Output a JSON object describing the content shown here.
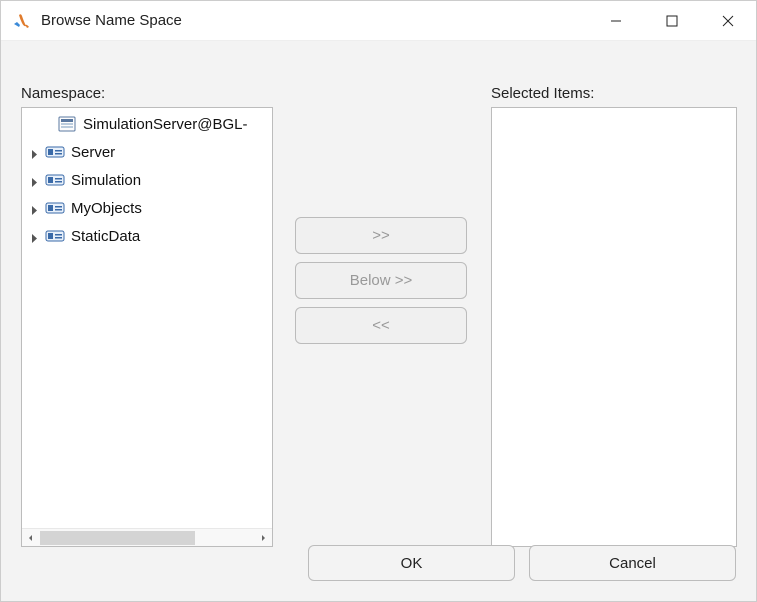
{
  "window": {
    "title": "Browse Name Space"
  },
  "labels": {
    "namespace": "Namespace:",
    "selected": "Selected Items:"
  },
  "tree": {
    "items": [
      {
        "label": "SimulationServer@BGL-",
        "icon": "server-root",
        "expandable": false,
        "root": true
      },
      {
        "label": "Server",
        "icon": "object",
        "expandable": true
      },
      {
        "label": "Simulation",
        "icon": "object",
        "expandable": true
      },
      {
        "label": "MyObjects",
        "icon": "object",
        "expandable": true
      },
      {
        "label": "StaticData",
        "icon": "object",
        "expandable": true
      }
    ]
  },
  "buttons": {
    "add": ">>",
    "below": "Below >>",
    "remove": "<<",
    "ok": "OK",
    "cancel": "Cancel"
  }
}
